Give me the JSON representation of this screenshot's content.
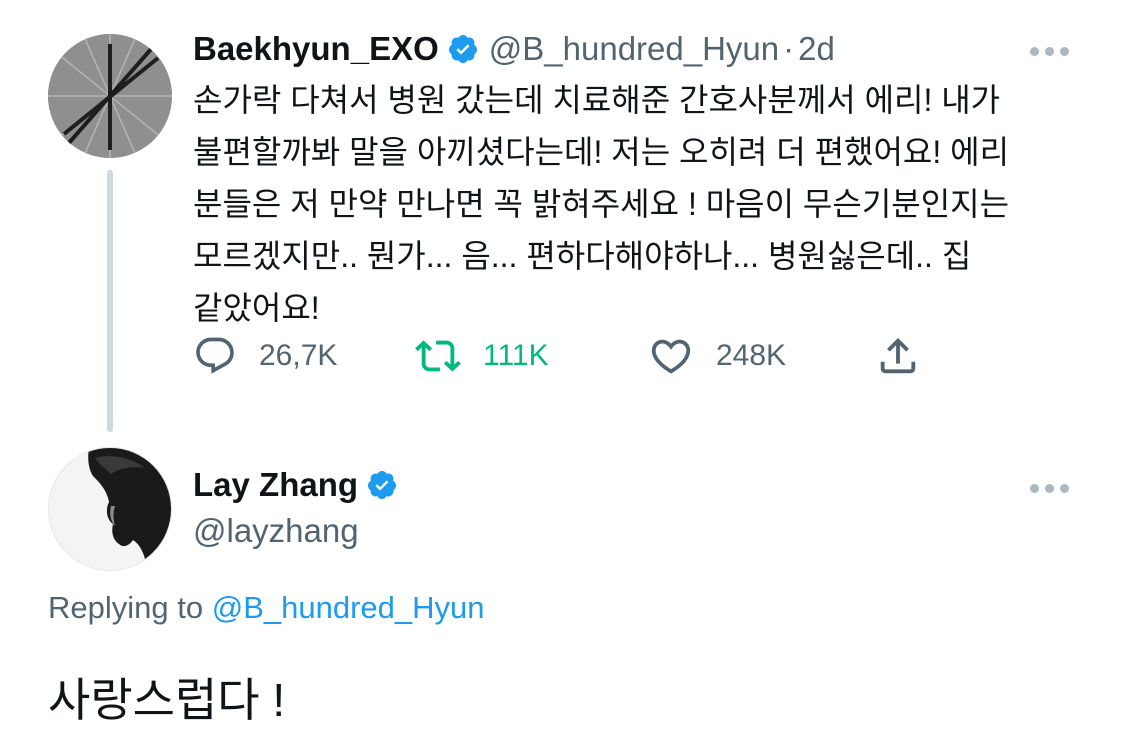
{
  "parent_tweet": {
    "display_name": "Baekhyun_EXO",
    "handle": "@B_hundred_Hyun",
    "separator": "·",
    "time": "2d",
    "text": "손가락 다쳐서 병원 갔는데 치료해준 간호사분께서 에리! 내가\n불편할까봐 말을 아끼셨다는데! 저는 오히려 더 편했어요! 에리\n분들은 저 만약 만나면 꼭 밝혀주세요 ! 마음이 무슨기분인지는\n모르겠지만.. 뭔가... 음... 편하다해야하나... 병원싫은데.. 집\n같았어요!",
    "actions": {
      "reply_count": "26,7K",
      "retweet_count": "111K",
      "like_count": "248K"
    },
    "retweeted": true
  },
  "reply_tweet": {
    "display_name": "Lay Zhang",
    "handle": "@layzhang",
    "replying_to_prefix": "Replying to",
    "replying_to_handle": "@B_hundred_Hyun",
    "text": "사랑스럽다 !"
  },
  "icons": {
    "verified": "verified-badge-icon",
    "more": "more-options-icon",
    "reply": "reply-icon",
    "retweet": "retweet-icon",
    "like": "heart-icon",
    "share": "share-icon"
  },
  "colors": {
    "text": "#0f1419",
    "secondary": "#536471",
    "link": "#1d9bf0",
    "retweet_active": "#00ba7c",
    "verified": "#1d9bf0",
    "thread_line": "#cfd9de"
  }
}
